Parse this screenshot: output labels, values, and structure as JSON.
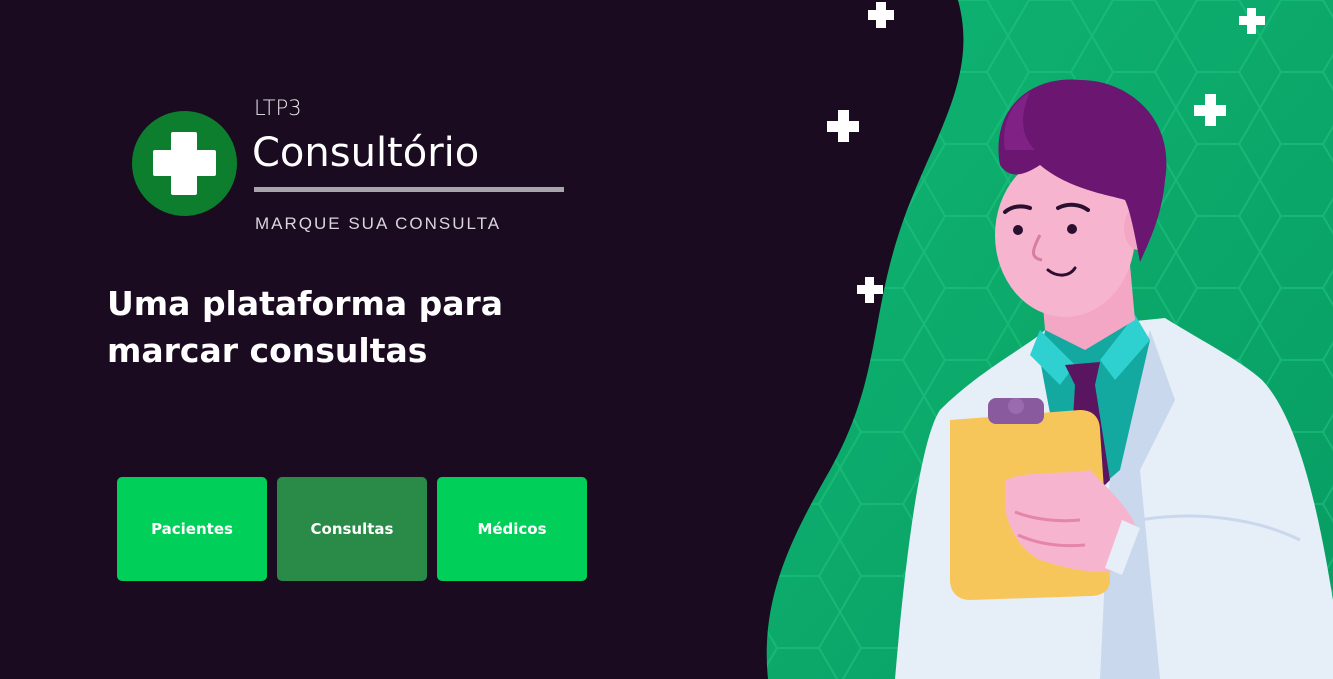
{
  "brand": {
    "superscript": "LTP3",
    "title": "Consultório",
    "tagline": "MARQUE SUA CONSULTA",
    "icon": "medical-cross-icon",
    "circle_color": "#0d7d2e"
  },
  "hero": {
    "headline_line1": "Uma plataforma para",
    "headline_line2": "marcar consultas"
  },
  "nav": {
    "buttons": [
      {
        "label": "Pacientes",
        "color": "#00d05a"
      },
      {
        "label": "Consultas",
        "color": "#2a8a47"
      },
      {
        "label": "Médicos",
        "color": "#00d05a"
      }
    ]
  },
  "illustration": {
    "subject": "doctor-with-clipboard",
    "background_color": "#0fa96e",
    "decor": "plus-icon"
  },
  "colors": {
    "page_background": "#1a0b20",
    "accent_green": "#00d05a",
    "active_green": "#2a8a47"
  }
}
